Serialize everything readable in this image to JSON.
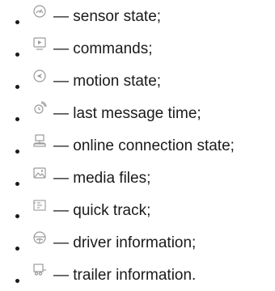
{
  "legend": {
    "items": [
      {
        "icon": "gauge-icon",
        "label": "— sensor state;"
      },
      {
        "icon": "play-monitor-icon",
        "label": "— commands;"
      },
      {
        "icon": "motion-arrow-icon",
        "label": "— motion state;"
      },
      {
        "icon": "signal-clock-icon",
        "label": "— last message time;"
      },
      {
        "icon": "network-computer-icon",
        "label": "— online connection state;"
      },
      {
        "icon": "image-icon",
        "label": "— media files;"
      },
      {
        "icon": "track-grid-icon",
        "label": "— quick track;"
      },
      {
        "icon": "steering-wheel-icon",
        "label": "— driver information;"
      },
      {
        "icon": "trailer-icon",
        "label": "— trailer information."
      }
    ]
  },
  "colors": {
    "icon_stroke": "#9a9a9a",
    "text": "#1a1a1a"
  }
}
